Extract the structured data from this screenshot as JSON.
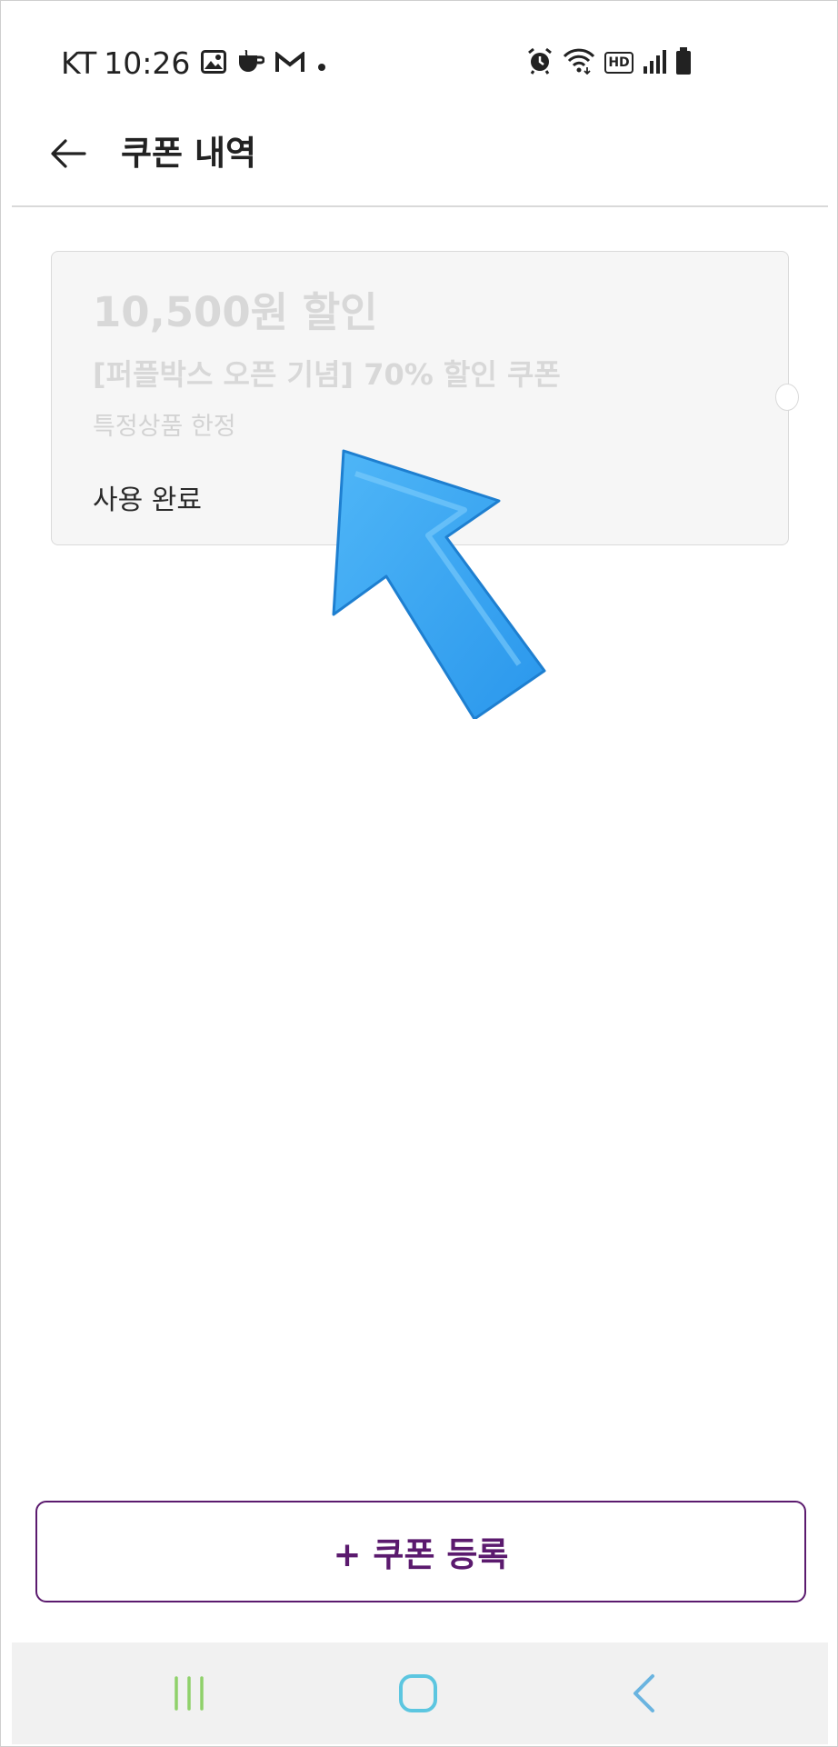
{
  "status_bar": {
    "carrier": "KT",
    "time": "10:26",
    "left_icons": [
      "image-icon",
      "coffee-icon",
      "gmail-icon",
      "dot-icon"
    ],
    "right_icons": [
      "alarm-icon",
      "wifi-icon",
      "hd-icon",
      "signal-icon",
      "battery-icon"
    ],
    "hd_label": "HD"
  },
  "header": {
    "back_icon": "arrow-left-icon",
    "title": "쿠폰 내역"
  },
  "coupon": {
    "amount": "10,500원 할인",
    "name": "[퍼플박스 오픈 기념] 70% 할인 쿠폰",
    "scope": "특정상품 한정",
    "status": "사용 완료"
  },
  "register_button": {
    "label": "+ 쿠폰 등록"
  },
  "nav_bar": {
    "recent_icon": "recent-apps-icon",
    "home_icon": "home-icon",
    "back_icon": "back-chevron-icon"
  },
  "colors": {
    "accent": "#5b1a6e",
    "arrow": "#3aa8f5",
    "nav_recent": "#8fd16a",
    "nav_home": "#5cc6e0",
    "nav_back": "#6ab4e0"
  }
}
